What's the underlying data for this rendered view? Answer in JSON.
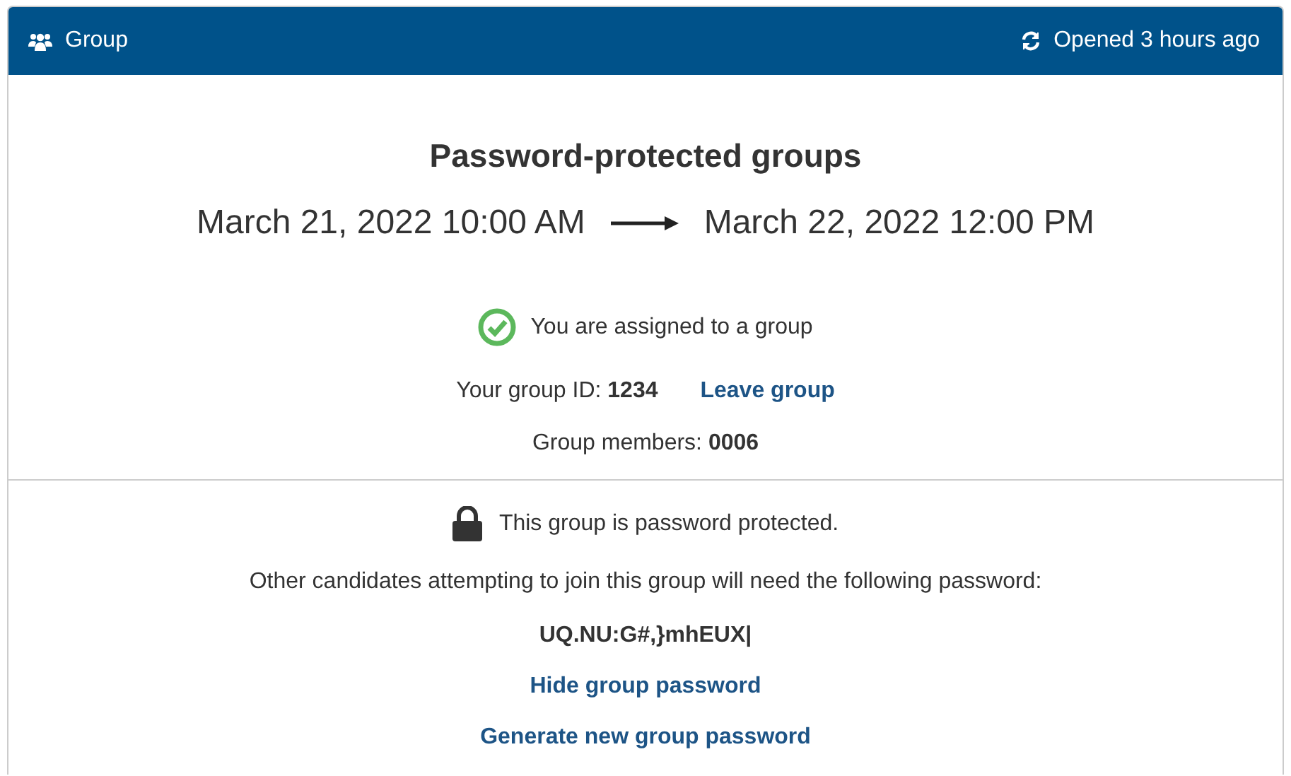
{
  "header": {
    "title": "Group",
    "status": "Opened 3 hours ago"
  },
  "title": "Password-protected groups",
  "period": {
    "start": "March 21, 2022 10:00 AM",
    "end": "March 22, 2022 12:00 PM"
  },
  "assignment": {
    "assigned": true,
    "message": "You are assigned to a group"
  },
  "group_id": "Your group ID: **1234**",
  "leave_link": "Leave group",
  "members": "Group members: **0006**",
  "protection": {
    "locked": true,
    "message": "This group is password protected."
  },
  "instructions": "Other candidates attempting to join this group will need the following password:",
  "password": "UQ.NU:G#,}mhEUX|",
  "links": [
    "Hide group password",
    "Generate new group password"
  ]
}
